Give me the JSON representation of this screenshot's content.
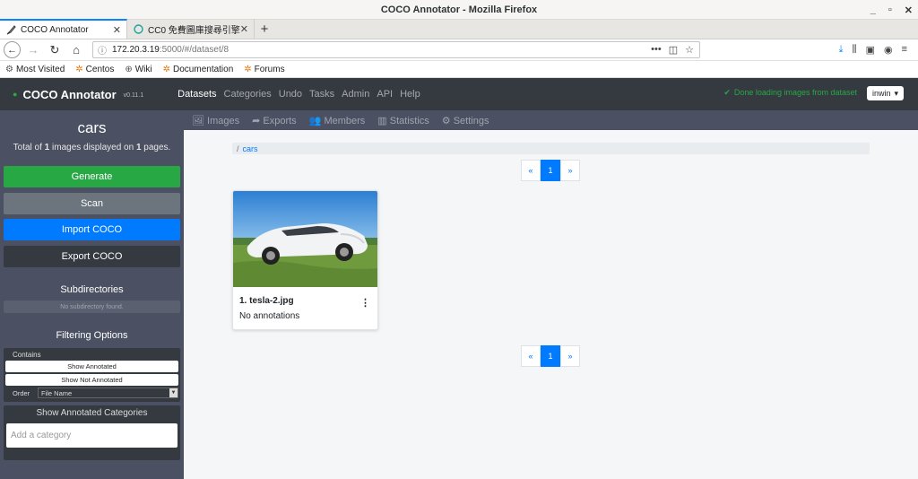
{
  "window": {
    "title": "COCO Annotator - Mozilla Firefox",
    "controls": [
      "_",
      "▫",
      "✕"
    ]
  },
  "tabs": [
    {
      "label": "COCO Annotator",
      "close": "✕"
    },
    {
      "label": "CC0 免費圖庫搜尋引擎",
      "close": "✕"
    }
  ],
  "newtab": "+",
  "address": {
    "host": "172.20.3.19",
    "rest": ":5000/#/dataset/8"
  },
  "bookmarks": [
    "Most Visited",
    "Centos",
    "Wiki",
    "Documentation",
    "Forums"
  ],
  "app": {
    "brand": "COCO Annotator",
    "version": "v0.11.1",
    "menu": [
      "Datasets",
      "Categories",
      "Undo",
      "Tasks",
      "Admin",
      "API",
      "Help"
    ],
    "status": "Done loading images from dataset",
    "user": "inwin"
  },
  "sidebar": {
    "title": "cars",
    "summary": {
      "prefix": "Total of ",
      "images": "1",
      "mid": " images displayed on ",
      "pages": "1",
      "suffix": " pages."
    },
    "buttons": {
      "generate": "Generate",
      "scan": "Scan",
      "import": "Import COCO",
      "export": "Export COCO"
    },
    "subdirectories": {
      "heading": "Subdirectories",
      "empty": "No subdirectory found."
    },
    "filtering": {
      "heading": "Filtering Options",
      "contains": "Contains",
      "show_annotated": "Show Annotated",
      "show_not_annotated": "Show Not Annotated",
      "order_label": "Order",
      "order_value": "File Name"
    },
    "categories": {
      "heading": "Show Annotated Categories",
      "placeholder": "Add a category"
    }
  },
  "subtabs": [
    "Images",
    "Exports",
    "Members",
    "Statistics",
    "Settings"
  ],
  "breadcrumb": {
    "sep": "/",
    "item": "cars"
  },
  "pager": {
    "prev": "«",
    "page": "1",
    "next": "»"
  },
  "images": [
    {
      "name": "1. tesla-2.jpg",
      "annotations": "No annotations"
    }
  ]
}
